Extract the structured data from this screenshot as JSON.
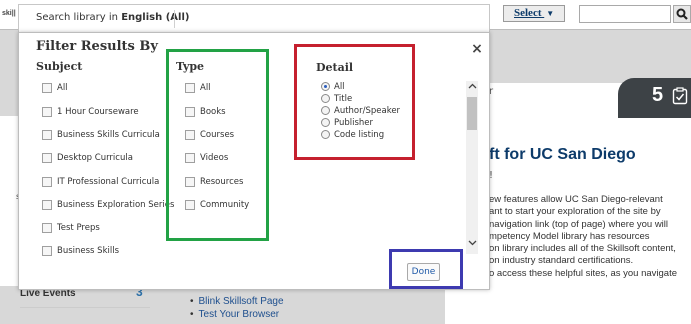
{
  "background": {
    "logo_text": "ski||",
    "truncated_topbar_text": "t",
    "select_button": {
      "label": "Select",
      "caret": "▼"
    },
    "search_icon": "magnifier-icon",
    "notification_count": "5",
    "truncated_right_text": "r",
    "headline": "ft for UC San Diego",
    "exclamation": "!",
    "paragraph_lines": [
      "ew features allow UC San Diego-relevant",
      "ant to start your exploration of the site by",
      "navigation link (top of page) where you will",
      "mpetency Model library has resources",
      "on library includes all of the Skillsoft content,",
      "on industry standard certifications."
    ],
    "paragraph2": "o access these helpful sites, as you navigate",
    "left_truncated": "s",
    "live_events_label": "Live Events",
    "live_events_count": "3",
    "links": [
      "Blink Skillsoft Page",
      "Test Your Browser"
    ]
  },
  "search_bar": {
    "prefix": "Search library in ",
    "language": "English (All)"
  },
  "modal": {
    "title": "Filter Results By",
    "close_label": "×",
    "done_label": "Done",
    "subject": {
      "heading": "Subject",
      "items": [
        "All",
        "1 Hour Courseware",
        "Business Skills Curricula",
        "Desktop Curricula",
        "IT Professional Curricula",
        "Business Exploration Series",
        "Test Preps",
        "Business Skills"
      ]
    },
    "type": {
      "heading": "Type",
      "items": [
        "All",
        "Books",
        "Courses",
        "Videos",
        "Resources",
        "Community"
      ]
    },
    "detail": {
      "heading": "Detail",
      "selected": "All",
      "options": [
        "All",
        "Title",
        "Author/Speaker",
        "Publisher",
        "Code listing"
      ]
    }
  },
  "colors": {
    "highlight_green": "#22a245",
    "highlight_red": "#c5202e",
    "highlight_blue": "#3d3ab0",
    "headline_blue": "#0d3b6a",
    "link_blue": "#1e4f8e"
  }
}
